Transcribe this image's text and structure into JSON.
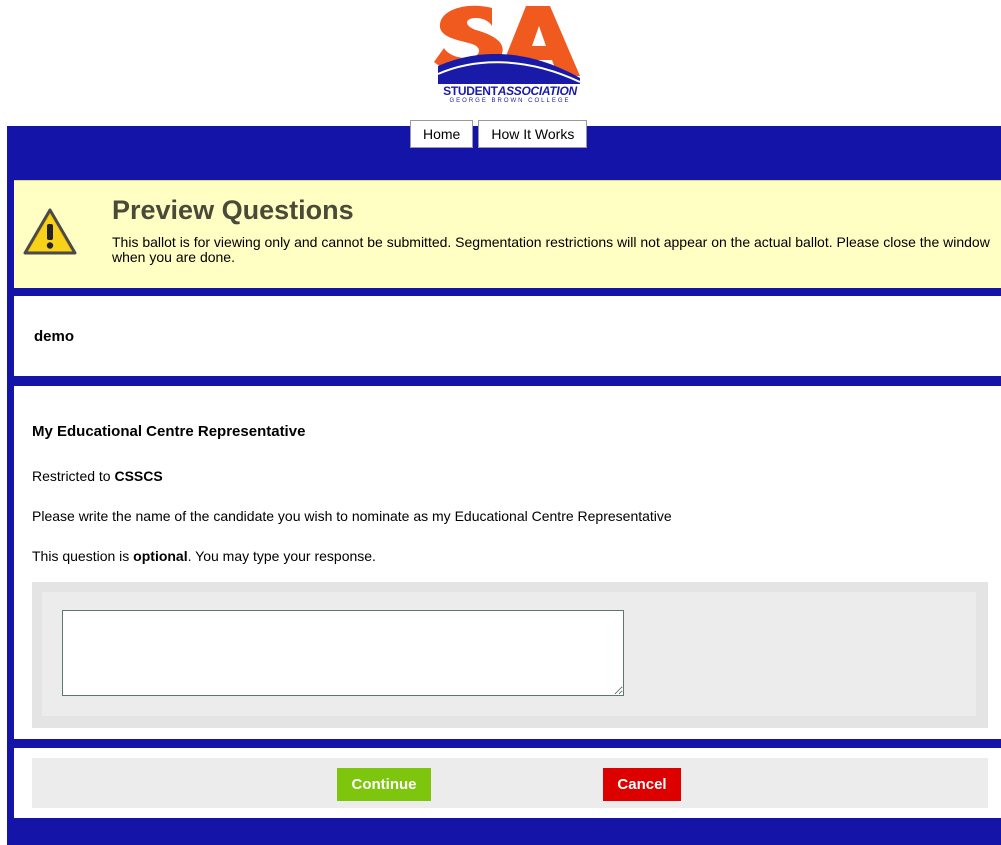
{
  "logo": {
    "letters": "SA",
    "student": "STUDENT",
    "association": "ASSOCIATION",
    "college": "GEORGE BROWN COLLEGE",
    "colors": {
      "orange": "#f05a1e",
      "blue": "#1a1aa8"
    }
  },
  "nav": {
    "items": [
      {
        "label": "Home"
      },
      {
        "label": "How It Works"
      }
    ]
  },
  "preview": {
    "icon": "warning-icon",
    "title": "Preview Questions",
    "description": "This ballot is for viewing only and cannot be submitted. Segmentation restrictions will not appear on the actual ballot. Please close the window when you are done."
  },
  "ballot": {
    "title": "demo"
  },
  "question": {
    "title": "My Educational Centre Representative",
    "restricted_prefix": "Restricted to ",
    "restricted_value": "CSSCS",
    "prompt": "Please write the name of the candidate you wish to nominate as my Educational Centre Representative",
    "optional_prefix": "This question is ",
    "optional_word": "optional",
    "optional_suffix": ". You may type your response.",
    "response_value": ""
  },
  "actions": {
    "continue_label": "Continue",
    "cancel_label": "Cancel"
  },
  "colors": {
    "frame": "#1414a8",
    "preview_bg": "#ffffc4",
    "continue": "#7ec60e",
    "cancel": "#dd0000"
  }
}
